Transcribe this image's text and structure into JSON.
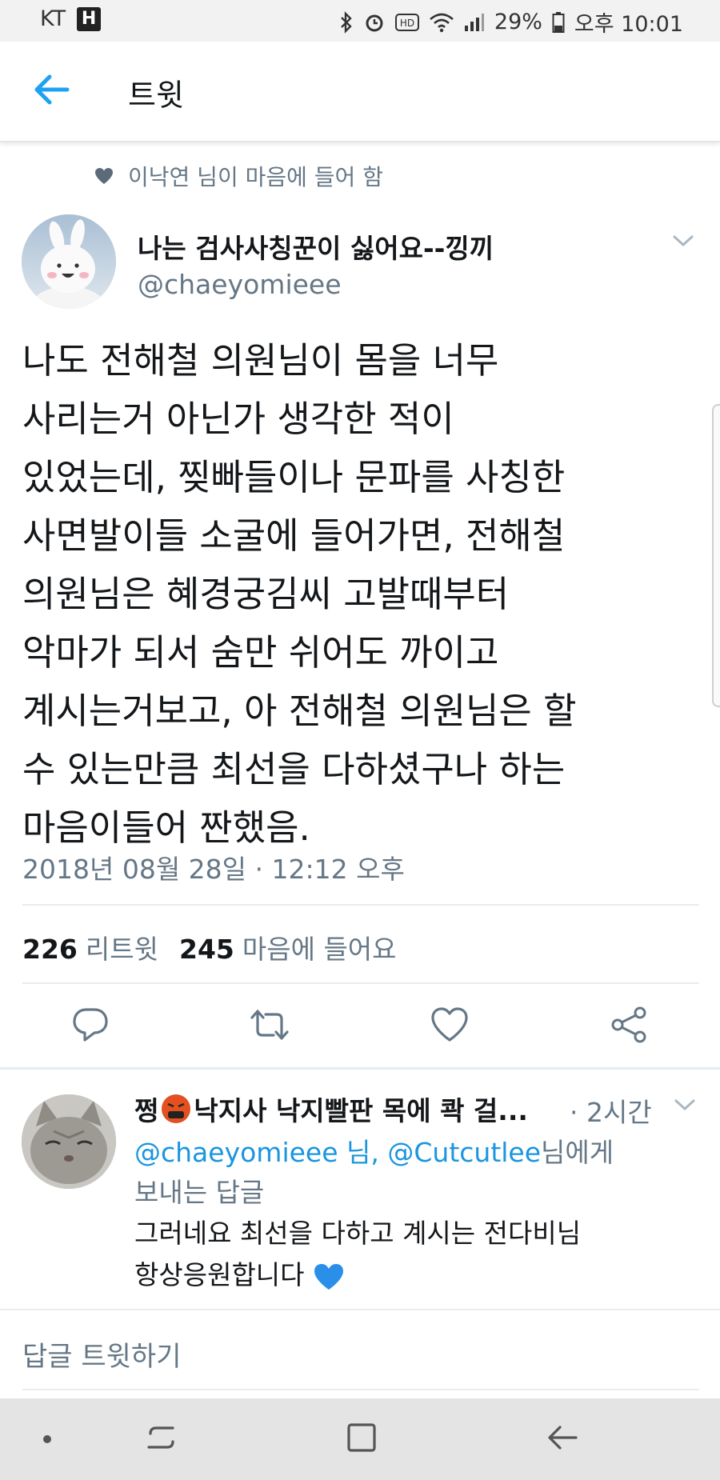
{
  "status_bar": {
    "carrier": "KT",
    "carrier_icon_letter": "H",
    "battery": "29%",
    "time": "오후 10:01",
    "icons": [
      "bluetooth-icon",
      "alarm-icon",
      "hd-icon",
      "wifi-icon",
      "signal-icon",
      "battery-icon"
    ]
  },
  "app_bar": {
    "back_icon": "arrow-left-icon",
    "title": "트윗"
  },
  "tweet": {
    "social_context": "이낙연 님이 마음에 들어 함",
    "author": {
      "name": "나는 검사사칭꾼이 싫어요--낑끼",
      "handle": "@chaeyomieee"
    },
    "text_lines": [
      "나도 전해철 의원님이 몸을 너무",
      "사리는거 아닌가 생각한 적이",
      "있었는데, 찢빠들이나 문파를 사칭한",
      "사면발이들 소굴에 들어가면, 전해철",
      "의원님은 혜경궁김씨 고발때부터",
      "악마가 되서 숨만 쉬어도 까이고",
      "계시는거보고, 아 전해철 의원님은 할",
      "수 있는만큼 최선을 다하셨구나 하는",
      "마음이들어 짠했음."
    ],
    "timestamp": "2018년 08월 28일 · 12:12 오후",
    "retweets_count": "226",
    "retweets_label": "리트윗",
    "likes_count": "245",
    "likes_label": "마음에 들어요",
    "actions": [
      "reply-icon",
      "retweet-icon",
      "like-icon",
      "share-icon"
    ]
  },
  "reply": {
    "name_prefix": "쩡",
    "name_rest": "낙지사 낙지빨판 목에 콱 걸...",
    "time": "· 2시간",
    "mention_1": "@chaeyomieee 님,",
    "mention_2": "@Cutcutlee",
    "reply_to_suffix": "님에게",
    "reply_to_line2": "보내는 답글",
    "body_line1": "그러네요 최선을 다하고 계시는 전다비님",
    "body_line2": "항상응원합니다"
  },
  "compose": {
    "placeholder": "답글 트윗하기"
  },
  "nav_bar": {
    "buttons": [
      "dot-icon",
      "recent-apps-icon",
      "home-icon",
      "back-icon"
    ]
  },
  "colors": {
    "accent": "#1da1f2",
    "link": "#1b95e0",
    "secondary_text": "#657786",
    "primary_text": "#14171a"
  }
}
